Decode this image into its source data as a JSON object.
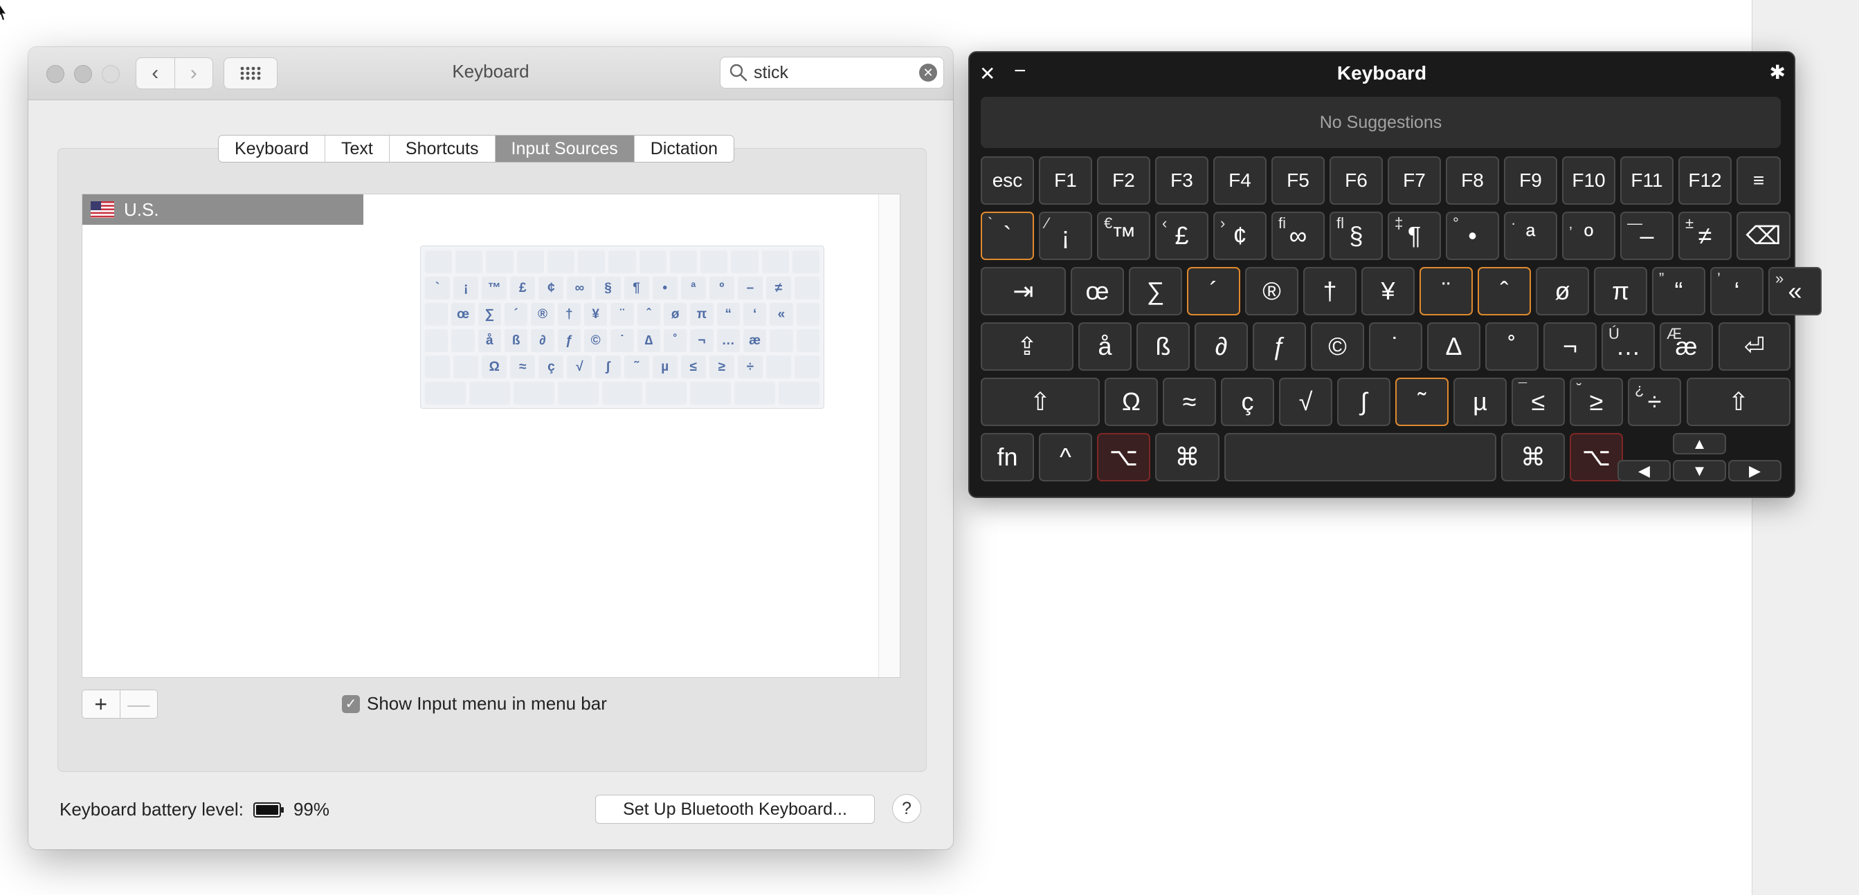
{
  "preferences": {
    "window_title": "Keyboard",
    "search": {
      "value": "stick",
      "placeholder": ""
    },
    "tabs": [
      "Keyboard",
      "Text",
      "Shortcuts",
      "Input Sources",
      "Dictation"
    ],
    "active_tab": "Input Sources",
    "input_sources": [
      {
        "label": "U.S.",
        "flag": "us-flag-icon"
      }
    ],
    "add_label": "+",
    "remove_label": "—",
    "show_input_menu_label": "Show Input menu in menu bar",
    "show_input_menu_checked": true,
    "battery_label": "Keyboard battery level:",
    "battery_level": 0.99,
    "battery_value": "99%",
    "bluetooth_button": "Set Up Bluetooth Keyboard...",
    "help_label": "?",
    "preview_rows": [
      [
        "`",
        "¡",
        "™",
        "£",
        "¢",
        "∞",
        "§",
        "¶",
        "•",
        "ª",
        "º",
        "–",
        "≠"
      ],
      [
        "œ",
        "∑",
        "´",
        "®",
        "†",
        "¥",
        "¨",
        "ˆ",
        "ø",
        "π",
        "“",
        "‘",
        "«"
      ],
      [
        "å",
        "ß",
        "∂",
        "ƒ",
        "©",
        "˙",
        "∆",
        "˚",
        "¬",
        "…",
        "æ"
      ],
      [
        "Ω",
        "≈",
        "ç",
        "√",
        "∫",
        "˜",
        "µ",
        "≤",
        "≥",
        "÷"
      ]
    ]
  },
  "viewer": {
    "title": "Keyboard",
    "close_label": "✕",
    "minimize_label": "−",
    "settings_icon": "gear-icon",
    "suggestions": "No Suggestions",
    "accent_color": "#e08a2e",
    "keys": {
      "esc": "esc",
      "f": [
        "F1",
        "F2",
        "F3",
        "F4",
        "F5",
        "F6",
        "F7",
        "F8",
        "F9",
        "F10",
        "F11",
        "F12"
      ],
      "list_icon": "≡",
      "row1": [
        {
          "m": "`",
          "s": "`"
        },
        {
          "m": "¡",
          "s": "⁄"
        },
        {
          "m": "™",
          "s": "€"
        },
        {
          "m": "£",
          "s": "‹"
        },
        {
          "m": "¢",
          "s": "›"
        },
        {
          "m": "∞",
          "s": "ﬁ"
        },
        {
          "m": "§",
          "s": "ﬂ"
        },
        {
          "m": "¶",
          "s": "‡"
        },
        {
          "m": "•",
          "s": "°"
        },
        {
          "m": "ª",
          "s": "·"
        },
        {
          "m": "º",
          "s": "‚"
        },
        {
          "m": "–",
          "s": "—"
        },
        {
          "m": "≠",
          "s": "±"
        }
      ],
      "row2": [
        {
          "m": "œ",
          "s": ""
        },
        {
          "m": "∑",
          "s": ""
        },
        {
          "m": "´",
          "s": ""
        },
        {
          "m": "®",
          "s": ""
        },
        {
          "m": "†",
          "s": ""
        },
        {
          "m": "¥",
          "s": ""
        },
        {
          "m": "¨",
          "s": ""
        },
        {
          "m": "ˆ",
          "s": ""
        },
        {
          "m": "ø",
          "s": ""
        },
        {
          "m": "π",
          "s": ""
        },
        {
          "m": "“",
          "s": "”"
        },
        {
          "m": "‘",
          "s": "’"
        },
        {
          "m": "«",
          "s": "»"
        }
      ],
      "row3": [
        {
          "m": "å",
          "s": ""
        },
        {
          "m": "ß",
          "s": ""
        },
        {
          "m": "∂",
          "s": ""
        },
        {
          "m": "ƒ",
          "s": ""
        },
        {
          "m": "©",
          "s": ""
        },
        {
          "m": "˙",
          "s": ""
        },
        {
          "m": "∆",
          "s": ""
        },
        {
          "m": "˚",
          "s": ""
        },
        {
          "m": "¬",
          "s": ""
        },
        {
          "m": "…",
          "s": "Ú"
        },
        {
          "m": "æ",
          "s": "Æ"
        }
      ],
      "row4": [
        {
          "m": "Ω",
          "s": ""
        },
        {
          "m": "≈",
          "s": ""
        },
        {
          "m": "ç",
          "s": ""
        },
        {
          "m": "√",
          "s": ""
        },
        {
          "m": "∫",
          "s": ""
        },
        {
          "m": "˜",
          "s": ""
        },
        {
          "m": "µ",
          "s": ""
        },
        {
          "m": "≤",
          "s": "¯"
        },
        {
          "m": "≥",
          "s": "˘"
        },
        {
          "m": "÷",
          "s": "¿"
        }
      ],
      "fn": "fn",
      "ctrl": "^",
      "option": "⌥",
      "command": "⌘",
      "tab": "⇥",
      "delete": "⌫",
      "capslock": "⇪",
      "return": "⏎",
      "shift": "⇧",
      "arrow_up": "▲",
      "arrow_down": "▼",
      "arrow_left": "◀",
      "arrow_right": "▶"
    }
  }
}
